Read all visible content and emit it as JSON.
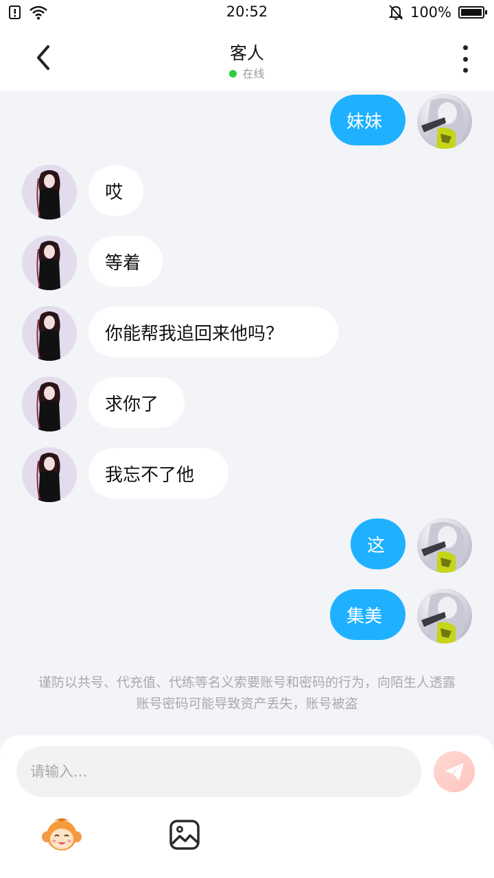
{
  "status_bar": {
    "time": "20:52",
    "battery": "100%"
  },
  "header": {
    "title": "客人",
    "status": "在线"
  },
  "messages": [
    {
      "side": "self",
      "text": "妹妹"
    },
    {
      "side": "other",
      "text": "哎"
    },
    {
      "side": "other",
      "text": "等着"
    },
    {
      "side": "other",
      "text": "你能帮我追回来他吗？"
    },
    {
      "side": "other",
      "text": "求你了"
    },
    {
      "side": "other",
      "text": "我忘不了他"
    },
    {
      "side": "self",
      "text": "这"
    },
    {
      "side": "self",
      "text": "集美"
    }
  ],
  "notice": "谨防以共号、代充值、代练等名义索要账号和密码的行为，向陌生人透露账号密码可能导致资产丢失，账号被盗",
  "input": {
    "placeholder": "请输入..."
  },
  "icons": {
    "back": "back-arrow-icon",
    "more": "more-vertical-icon",
    "send": "send-plane-icon",
    "emoji": "emoji-monkey-icon",
    "image": "image-picker-icon"
  },
  "colors": {
    "self_bubble": "#1fb1ff",
    "other_bubble": "#ffffff",
    "online": "#2ecc40",
    "send_button": "#ffc5c0"
  }
}
